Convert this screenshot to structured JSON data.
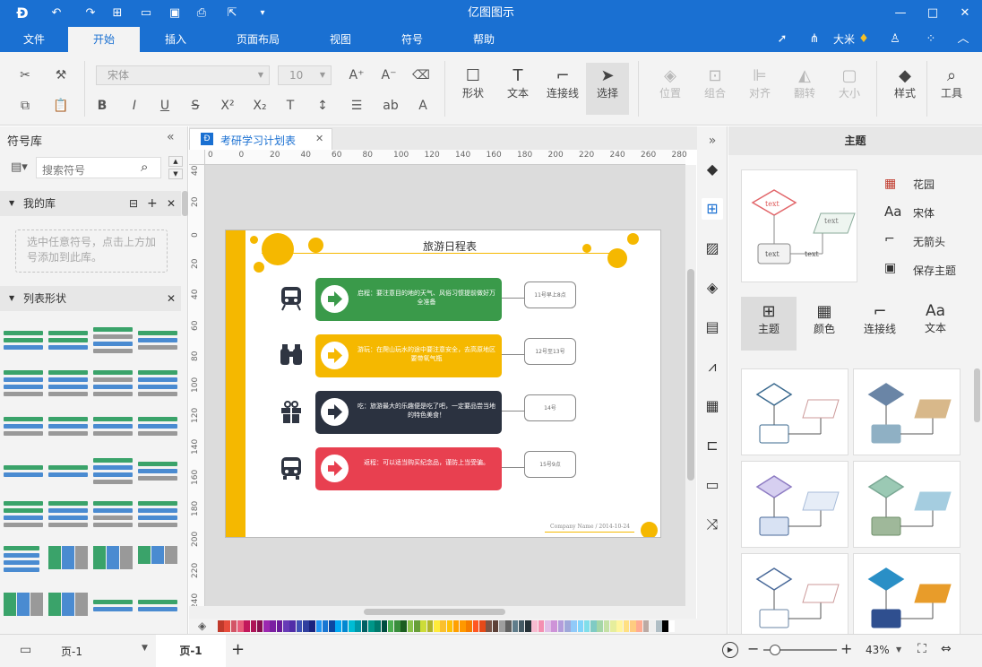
{
  "app_title": "亿图图示",
  "menu": [
    "文件",
    "开始",
    "插入",
    "页面布局",
    "视图",
    "符号",
    "帮助"
  ],
  "user": {
    "name": "大米"
  },
  "ribbon": {
    "font_name": "宋体",
    "font_size": "10",
    "big_buttons": [
      "形状",
      "文本",
      "连接线",
      "选择"
    ],
    "disabled_buttons": [
      "位置",
      "组合",
      "对齐",
      "翻转",
      "大小"
    ],
    "right_buttons": [
      "样式",
      "工具"
    ]
  },
  "left": {
    "title": "符号库",
    "search_placeholder": "搜索符号",
    "mylib": {
      "title": "我的库",
      "hint": "选中任意符号，点击上方加号添加到此库。"
    },
    "list": {
      "title": "列表形状"
    }
  },
  "doc_tab": {
    "name": "考研学习计划表"
  },
  "ruler": {
    "h": [
      "0",
      "0",
      "20",
      "40",
      "60",
      "80",
      "100",
      "120",
      "140",
      "160",
      "180",
      "200",
      "220",
      "240",
      "260",
      "280",
      "300"
    ],
    "v": [
      "40",
      "20",
      "0",
      "20",
      "40",
      "60",
      "80",
      "100",
      "120",
      "140",
      "160",
      "180",
      "200",
      "220",
      "240"
    ]
  },
  "diagram": {
    "title": "旅游日程表",
    "rows": [
      {
        "text": "启程：要注意目的地的天气、风俗习惯提前做好万全准备",
        "bubble": "11号早上8点",
        "color": "#3a9a4a",
        "icon": "train-icon"
      },
      {
        "text": "游玩：在爬山玩水的途中要注意安全，去高原地区要带氧气瓶",
        "bubble": "12号至13号",
        "color": "#f5b800",
        "icon": "binoculars-icon"
      },
      {
        "text": "吃：旅游最大的乐趣便是吃了吧，一定要品尝当地的特色美食！",
        "bubble": "14号",
        "color": "#2b3240",
        "icon": "gift-icon"
      },
      {
        "text": "返程：可以适当购买纪念品，谨防上当受骗。",
        "bubble": "15号9点",
        "color": "#e84050",
        "icon": "bus-icon"
      }
    ],
    "footer": "Company Name / 2014-10-24"
  },
  "right": {
    "title": "主题",
    "options": [
      {
        "label": "花园"
      },
      {
        "label": "宋体"
      },
      {
        "label": "无箭头"
      },
      {
        "label": "保存主题"
      }
    ],
    "tabs": [
      "主题",
      "颜色",
      "连接线",
      "文本"
    ],
    "preview_text": "text"
  },
  "status": {
    "page_selector": "页-1",
    "page_tab": "页-1",
    "zoom": "43%",
    "zoom_level": 0.43
  },
  "colors": {
    "brand": "#1a70d2",
    "accent_yellow": "#f5b800"
  }
}
